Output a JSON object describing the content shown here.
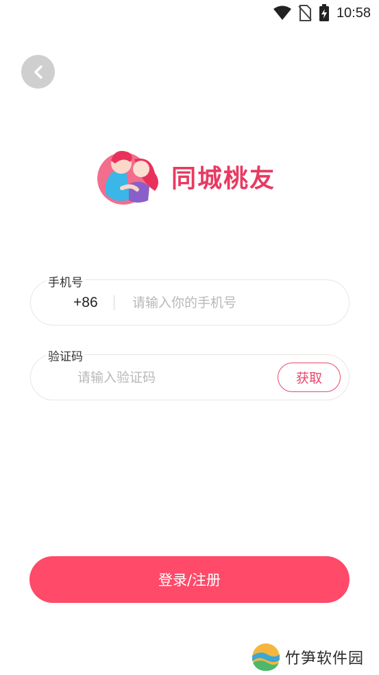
{
  "status_bar": {
    "time": "10:58",
    "icons": [
      "wifi-icon",
      "no-sim-icon",
      "battery-charging-icon"
    ]
  },
  "header": {
    "back_icon": "chevron-left-icon"
  },
  "logo": {
    "app_name": "同城桃友",
    "colors": {
      "brand": "#e83a62",
      "accent": "#ff4a69"
    }
  },
  "form": {
    "phone": {
      "label": "手机号",
      "country_code": "+86",
      "placeholder": "请输入你的手机号",
      "value": ""
    },
    "code": {
      "label": "验证码",
      "placeholder": "请输入验证码",
      "value": "",
      "get_code_label": "获取"
    }
  },
  "actions": {
    "login_label": "登录/注册"
  },
  "watermark": {
    "text": "竹笋软件园"
  }
}
